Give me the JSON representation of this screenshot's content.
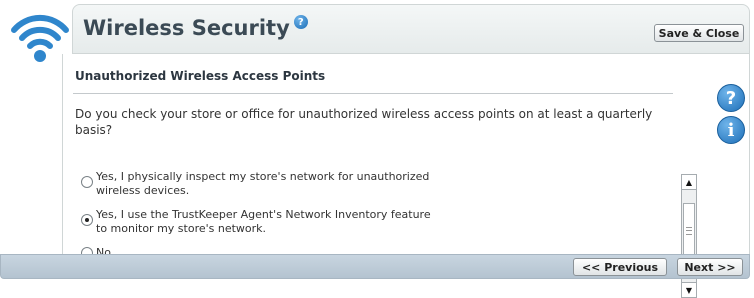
{
  "header": {
    "title": "Wireless Security",
    "help_glyph": "?",
    "save_close_label": "Save & Close"
  },
  "section": {
    "title": "Unauthorized Wireless Access Points",
    "question": "Do you check your store or office for unauthorized wireless access points on at least a quarterly basis?"
  },
  "options": [
    {
      "line1": "Yes, I physically inspect my store's network for unauthorized",
      "line2": "wireless devices.",
      "checked": false
    },
    {
      "line1": "Yes, I use the TrustKeeper Agent's Network Inventory feature",
      "line2": "to monitor my store's network.",
      "checked": true
    },
    {
      "line1": "No",
      "line2": "",
      "checked": false
    }
  ],
  "side_icons": {
    "help": "?",
    "info": "i"
  },
  "footer": {
    "previous_label": "<< Previous",
    "next_label": "Next >>"
  },
  "icons": [
    "wifi-icon",
    "help-icon",
    "info-icon",
    "scroll-up-arrow-icon",
    "scroll-down-arrow-icon"
  ],
  "colors": {
    "accent": "#1e6fb8",
    "title": "#3b4a55",
    "footer": "#b4c3d0"
  }
}
